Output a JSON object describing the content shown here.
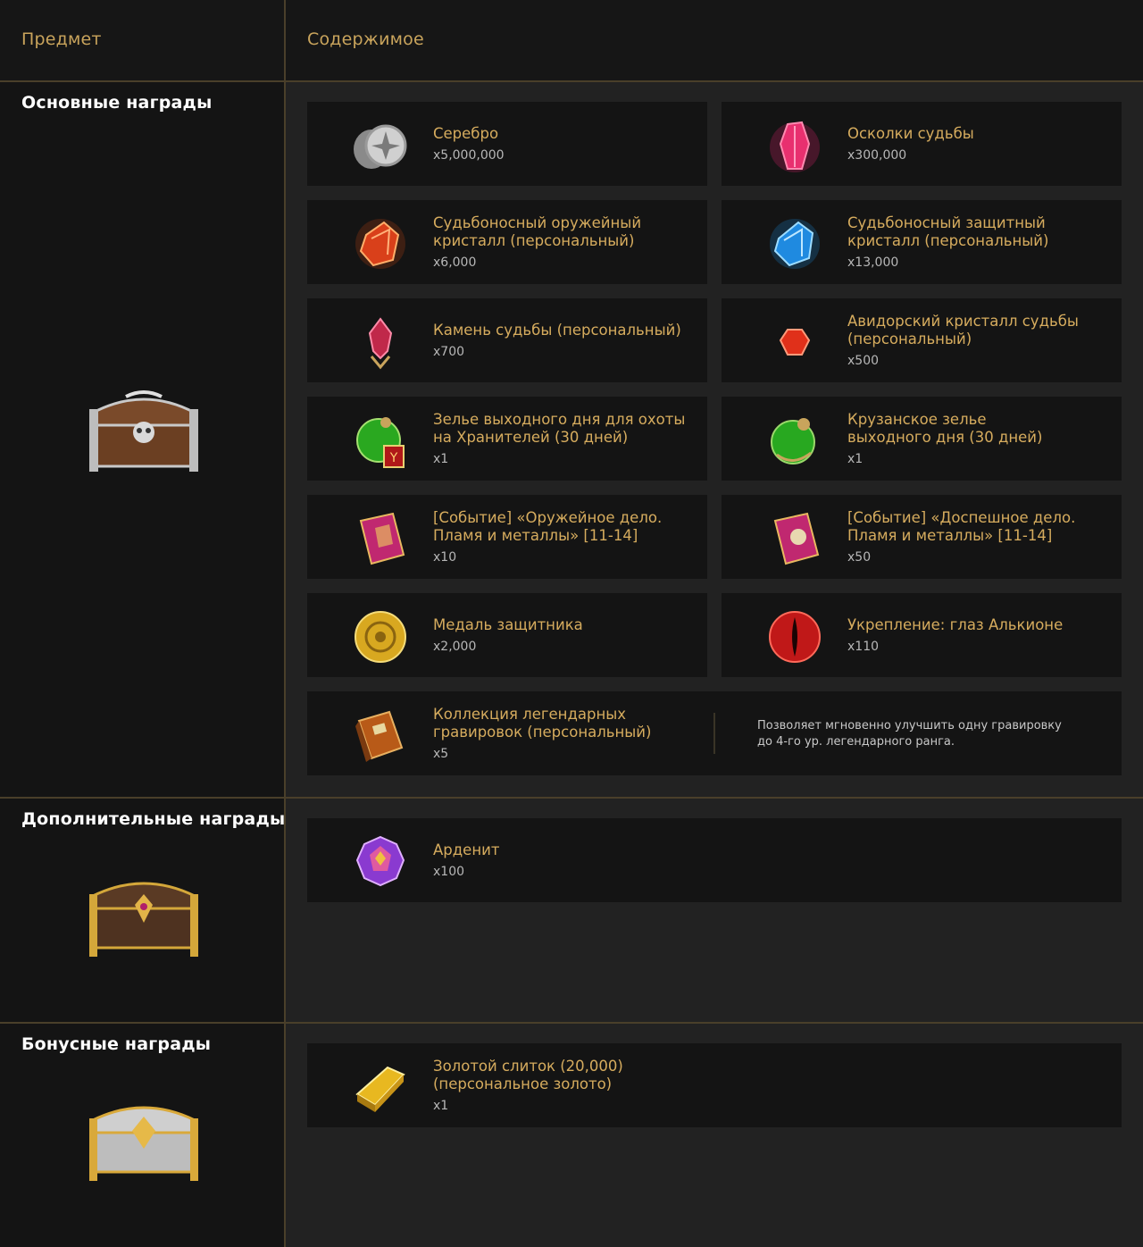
{
  "header": {
    "item_label": "Предмет",
    "content_label": "Содержимое"
  },
  "sections": [
    {
      "title": "Основные награды",
      "chest_icon": "brown-silver-skull-chest-icon"
    },
    {
      "title": "Дополнительные награды",
      "chest_icon": "brown-gold-chest-icon"
    },
    {
      "title": "Бонусные награды",
      "chest_icon": "silver-gold-chest-icon"
    }
  ],
  "main_items": [
    {
      "name": "Серебро",
      "qty": "x5,000,000",
      "icon": "silver-coins-icon"
    },
    {
      "name": "Осколки судьбы",
      "qty": "x300,000",
      "icon": "pink-crystal-shard-icon"
    },
    {
      "name": "Судьбоносный оружейный кристалл (персональный)",
      "name_line1": "Судьбоносный оружейный",
      "name_line2": "кристалл (персональный)",
      "qty": "x6,000",
      "icon": "orange-crystal-icon"
    },
    {
      "name": "Судьбоносный защитный кристалл (персональный)",
      "name_line1": "Судьбоносный защитный",
      "name_line2": "кристалл (персональный)",
      "qty": "x13,000",
      "icon": "blue-crystal-icon"
    },
    {
      "name": "Камень судьбы (персональный)",
      "qty": "x700",
      "icon": "destiny-stone-icon"
    },
    {
      "name": "Авидорский кристалл судьбы (персональный)",
      "name_line1": "Авидорский кристалл судьбы",
      "name_line2": "(персональный)",
      "qty": "x500",
      "icon": "red-gem-icon"
    },
    {
      "name": "Зелье выходного дня для охоты на Хранителей (30 дней)",
      "name_line1": "Зелье выходного дня для охоты",
      "name_line2": "на Хранителей (30 дней)",
      "qty": "x1",
      "icon": "green-potion-badge-icon"
    },
    {
      "name": "Крузанское зелье выходного дня (30 дней)",
      "name_line1": "Крузанское зелье",
      "name_line2": "выходного дня (30 дней)",
      "qty": "x1",
      "icon": "green-potion-icon"
    },
    {
      "name": "[Событие] «Оружейное дело. Пламя и металлы» [11-14]",
      "name_line1": "[Событие] «Оружейное дело.",
      "name_line2": "Пламя и металлы» [11-14]",
      "qty": "x10",
      "icon": "pink-book-icon"
    },
    {
      "name": "[Событие] «Доспешное дело. Пламя и металлы» [11-14]",
      "name_line1": "[Событие] «Доспешное дело.",
      "name_line2": "Пламя и металлы» [11-14]",
      "qty": "x50",
      "icon": "pink-book-icon"
    },
    {
      "name": "Медаль защитника",
      "qty": "x2,000",
      "icon": "gold-medal-icon"
    },
    {
      "name": "Укрепление: глаз Алькионе",
      "qty": "x110",
      "icon": "red-eye-icon"
    }
  ],
  "main_wide_item": {
    "name_line1": "Коллекция легендарных",
    "name_line2": "гравировок (персональный)",
    "qty": "x5",
    "icon": "orange-engraving-book-icon",
    "desc_line1": "Позволяет мгновенно улучшить одну гравировку",
    "desc_line2": "до 4-го ур. легендарного ранга."
  },
  "extra_items": [
    {
      "name": "Арденит",
      "qty": "x100",
      "icon": "rainbow-gem-icon"
    }
  ],
  "bonus_items": [
    {
      "name_line1": "Золотой слиток (20,000)",
      "name_line2": "(персональное золото)",
      "qty": "x1",
      "icon": "gold-bar-icon"
    }
  ],
  "colors": {
    "accent_gold": "#d6ac5e",
    "header_gold": "#c9a45c",
    "divider": "#4a3f2a",
    "card_bg": "#141414",
    "panel_bg": "#222222"
  }
}
